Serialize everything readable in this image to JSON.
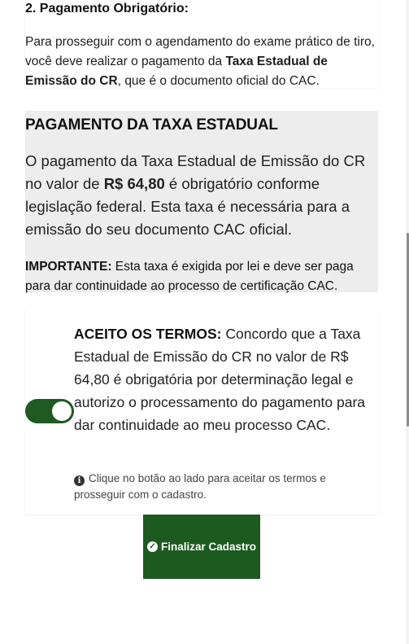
{
  "step": {
    "title": "2. Pagamento Obrigatório:",
    "text_before": "Para prosseguir com o agendamento do exame prático de tiro, você deve realizar o pagamento da ",
    "text_bold": "Taxa Estadual de Emissão do CR",
    "text_after": ", que é o documento oficial do CAC."
  },
  "tax": {
    "title": "PAGAMENTO DA TAXA ESTADUAL",
    "text_before": "O pagamento da Taxa Estadual de Emissão do CR no valor de ",
    "amount": "R$ 64,80",
    "text_after": " é obrigatório conforme legislação federal. Esta taxa é necessária para a emissão do seu documento CAC oficial.",
    "important_label": "IMPORTANTE:",
    "important_text": " Esta taxa é exigida por lei e deve ser paga para dar continuidade ao processo de certificação CAC."
  },
  "terms": {
    "toggle_state": "on",
    "label": "ACEITO OS TERMOS:",
    "text": " Concordo que a Taxa Estadual de Emissão do CR no valor de R$ 64,80 é obrigatória por determinação legal e autorizo o processamento do pagamento para dar continuidade ao meu processo CAC.",
    "hint_icon": "info-circle-icon",
    "hint": "Clique no botão ao lado para aceitar os termos e prosseguir com o cadastro."
  },
  "actions": {
    "finalize_icon": "check-circle-icon",
    "finalize_label": "Finalizar Cadastro"
  },
  "colors": {
    "accent_green": "#1d5a20",
    "tax_box_bg": "#ededed"
  }
}
